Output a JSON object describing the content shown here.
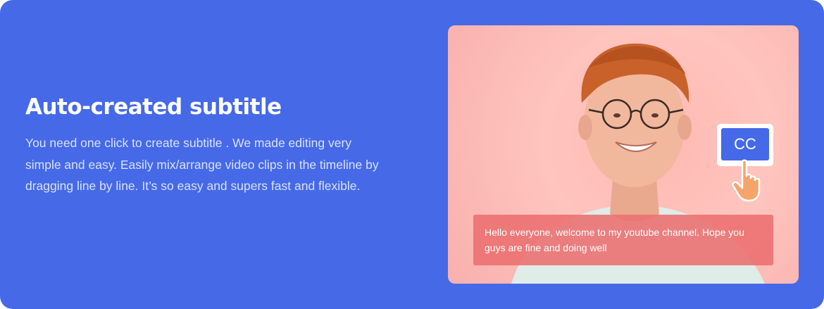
{
  "feature": {
    "title": "Auto-created subtitle",
    "description": "You need one click to create subtitle . We made editing very simple and easy. Easily mix/arrange video clips in the timeline by dragging line by line. It’s so easy and supers fast and flexible."
  },
  "preview": {
    "cc_label": "CC",
    "caption": "Hello everyone, welcome to my youtube channel. Hope you guys are fine and doing well"
  },
  "colors": {
    "card_bg": "#4669e8",
    "preview_bg": "#ffc4be",
    "caption_bg": "#ec6e6e",
    "cc_button": "#4669e8"
  },
  "icons": [
    "cc-icon",
    "pointing-hand-icon"
  ]
}
